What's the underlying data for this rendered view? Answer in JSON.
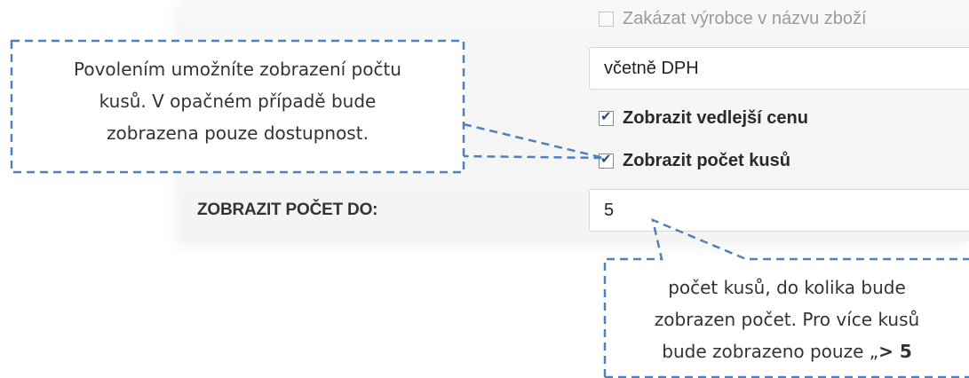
{
  "settings": {
    "hide_manufacturer_label": "Zakázat výrobce v názvu zboží",
    "price_select_value": "včetně DPH",
    "show_secondary_price_label": "Zobrazit vedlejší cenu",
    "show_quantity_label": "Zobrazit počet kusů",
    "show_count_up_to_label": "ZOBRAZIT POČET DO:",
    "show_count_up_to_value": "5"
  },
  "callouts": {
    "left_lines": [
      "Povolením umožníte zobrazení počtu",
      "kusů. V opačném případě bude",
      "zobrazena pouze dostupnost."
    ],
    "right_lines": [
      "počet kusů, do kolika bude",
      "zobrazen počet. Pro více kusů",
      "bude zobrazeno pouze „",
      "> 5"
    ]
  },
  "colors": {
    "callout_border": "#4f81bd",
    "checkbox_check": "#2b4a8a"
  }
}
